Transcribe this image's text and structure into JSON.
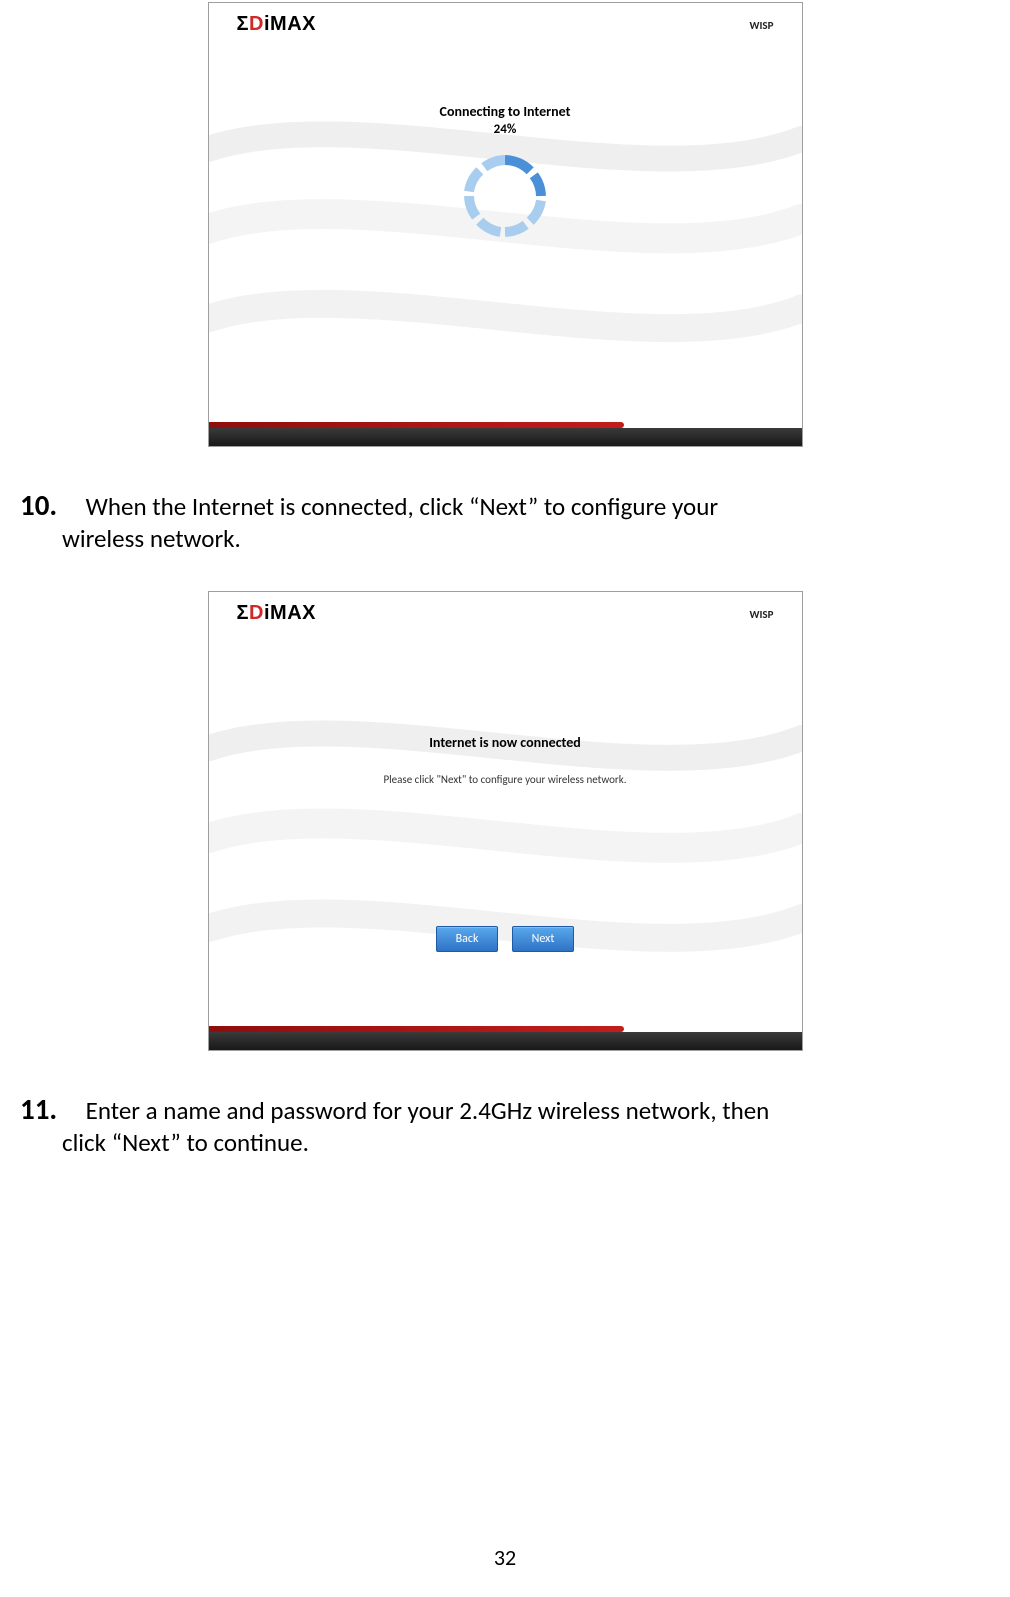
{
  "page_number": "32",
  "screenshot1": {
    "brand_logo_text": "EDIMAX",
    "mode_label": "WISP",
    "title": "Connecting to Internet",
    "progress_percent": "24%"
  },
  "step10": {
    "number": "10.",
    "text_line1": "When the Internet is connected, click “Next” to configure your",
    "text_line2": "wireless network."
  },
  "screenshot2": {
    "brand_logo_text": "EDIMAX",
    "mode_label": "WISP",
    "title": "Internet is now connected",
    "subtitle": "Please click \"Next\" to configure your wireless network.",
    "back_button": "Back",
    "next_button": "Next"
  },
  "step11": {
    "number": "11.",
    "text_line1": "Enter a name and password for your 2.4GHz wireless network, then",
    "text_line2": "click “Next” to continue."
  }
}
